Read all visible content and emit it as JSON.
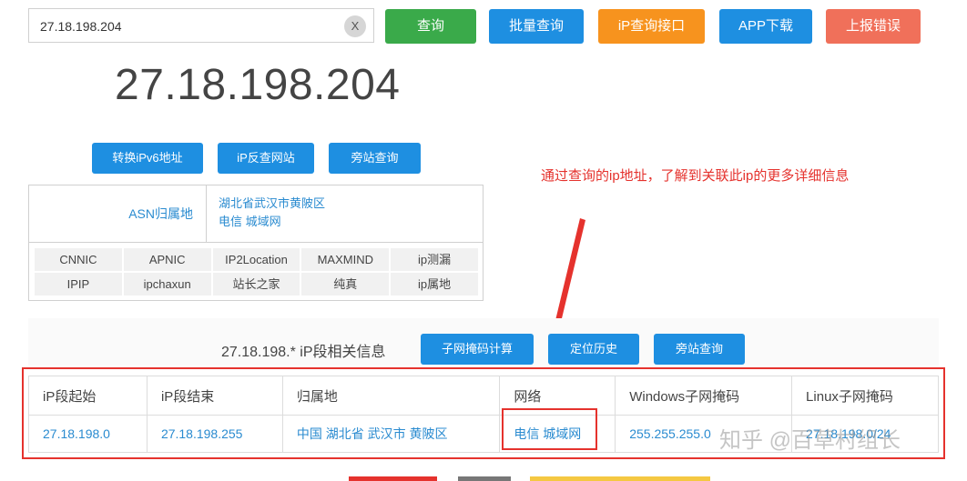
{
  "search": {
    "value": "27.18.198.204",
    "clear_label": "X"
  },
  "toolbar": {
    "buttons": [
      {
        "label": "查询",
        "color": "#3aaa4a"
      },
      {
        "label": "批量查询",
        "color": "#1e8fe1"
      },
      {
        "label": "iP查询接口",
        "color": "#f7931e"
      },
      {
        "label": "APP下载",
        "color": "#1e8fe1"
      },
      {
        "label": "上报错误",
        "color": "#f0705a"
      }
    ]
  },
  "ip_display": "27.18.198.204",
  "actions": {
    "ipv6": "转换iPv6地址",
    "reverse": "iP反查网站",
    "side": "旁站查询"
  },
  "asn": {
    "label": "ASN归属地",
    "location": "湖北省武汉市黄陂区",
    "network": "电信 城域网"
  },
  "sources": [
    "CNNIC",
    "APNIC",
    "IP2Location",
    "MAXMIND",
    "ip测漏",
    "IPIP",
    "ipchaxun",
    "站长之家",
    "纯真",
    "ip属地"
  ],
  "annotation": "通过查询的ip地址，了解到关联此ip的更多详细信息",
  "segment": {
    "title": "27.18.198.* iP段相关信息",
    "buttons": [
      "子网掩码计算",
      "定位历史",
      "旁站查询"
    ],
    "headers": [
      "iP段起始",
      "iP段结束",
      "归属地",
      "网络",
      "Windows子网掩码",
      "Linux子网掩码"
    ],
    "row": [
      "27.18.198.0",
      "27.18.198.255",
      "中国 湖北省 武汉市 黄陂区",
      "电信 城域网",
      "255.255.255.0",
      "27.18.198.0/24"
    ]
  },
  "watermark": "知乎 @百草村组长"
}
